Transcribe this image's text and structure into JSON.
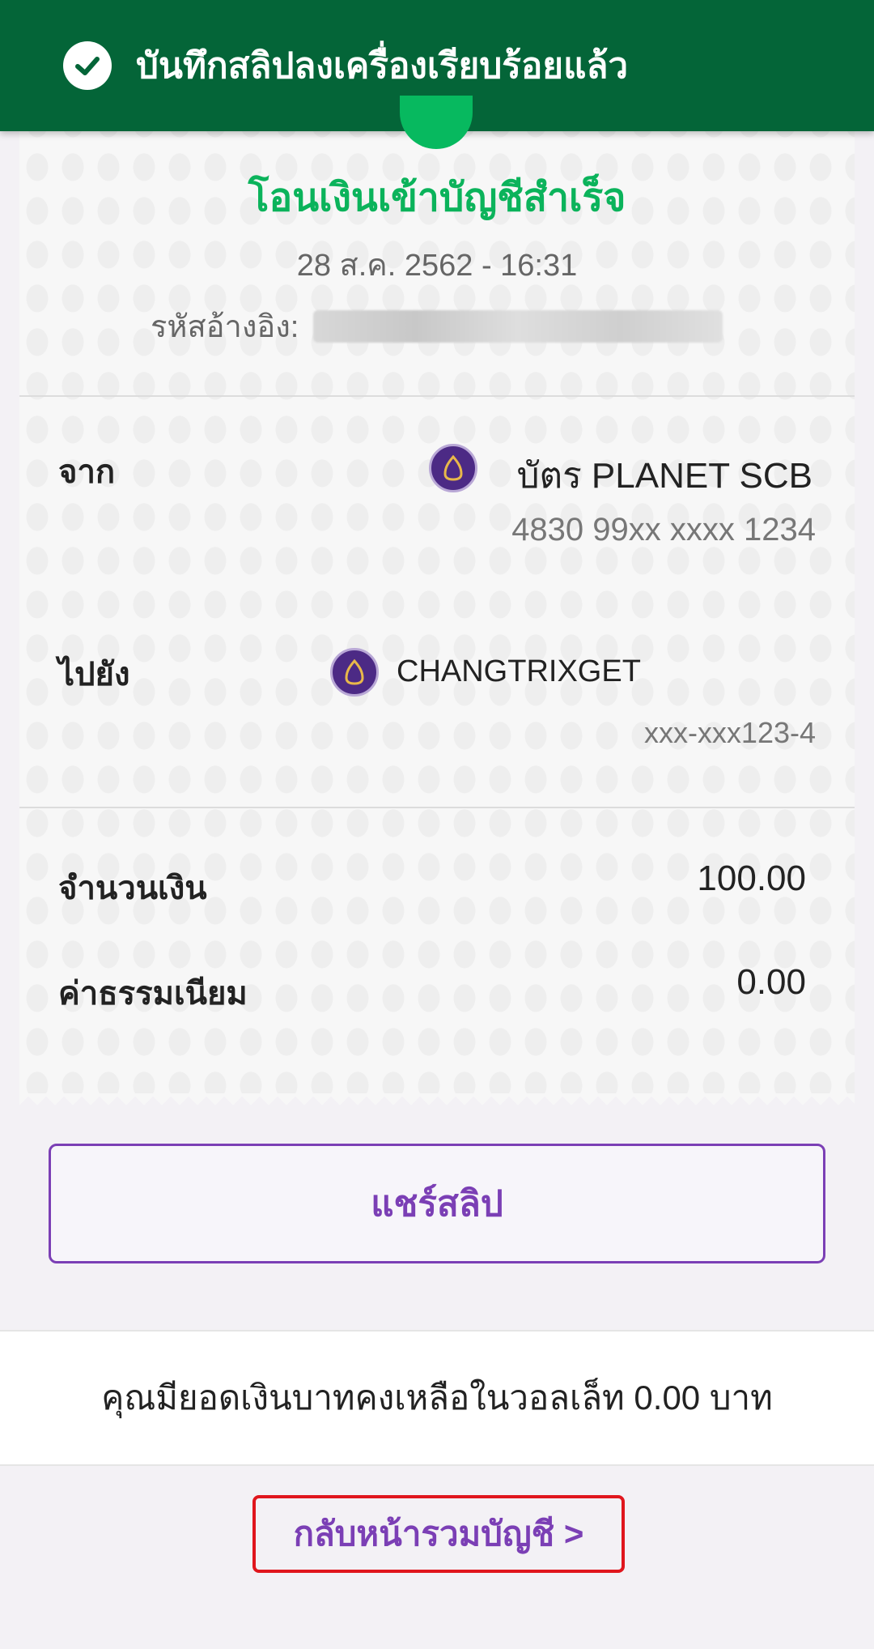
{
  "toast": {
    "message": "บันทึกสลิปลงเครื่องเรียบร้อยแล้ว"
  },
  "receipt": {
    "status_title": "โอนเงินเข้าบัญชีสำเร็จ",
    "datetime": "28 ส.ค. 2562 - 16:31",
    "reference_label": "รหัสอ้างอิง:",
    "from": {
      "label": "จาก",
      "name": "บัตร PLANET SCB",
      "number": "4830 99xx xxxx 1234"
    },
    "to": {
      "label": "ไปยัง",
      "name": "CHANGTRIXGET",
      "number": "xxx-xxx123-4"
    },
    "amount": {
      "label": "จำนวนเงิน",
      "value": "100.00"
    },
    "fee": {
      "label": "ค่าธรรมเนียม",
      "value": "0.00"
    }
  },
  "actions": {
    "share_label": "แชร์สลิป",
    "back_label": "กลับหน้ารวมบัญชี >"
  },
  "balance_text": "คุณมียอดเงินบาทคงเหลือในวอลเล็ท 0.00 บาท",
  "colors": {
    "toast_bg": "#046538",
    "success_green": "#0bb35b",
    "brand_purple": "#7b3fb5",
    "highlight_red": "#e0161d"
  }
}
